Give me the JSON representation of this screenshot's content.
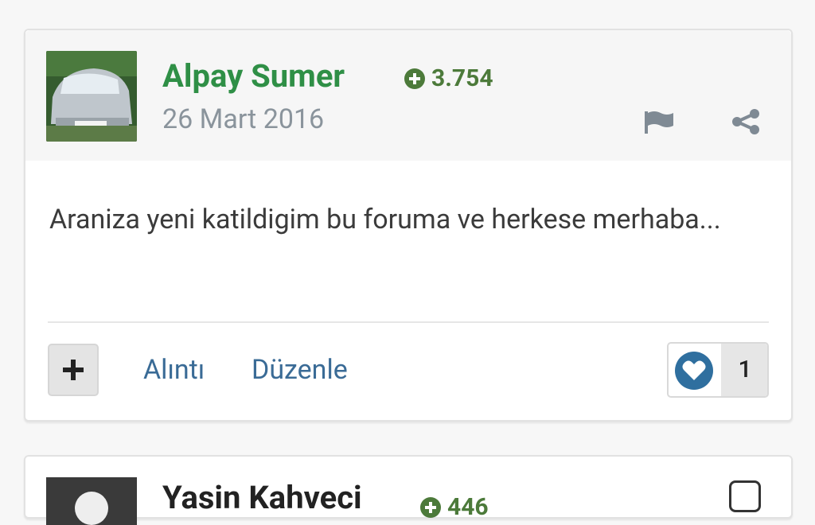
{
  "post": {
    "author": "Alpay Sumer",
    "reputation": "3.754",
    "date": "26 Mart 2016",
    "body": "Araniza yeni katildigim bu foruma ve herkese merhaba...",
    "actions": {
      "quote_label": "Alıntı",
      "edit_label": "Düzenle"
    },
    "like_count": "1"
  },
  "next_post": {
    "author": "Yasin Kahveci",
    "reputation": "446"
  },
  "colors": {
    "author": "#2f8f46",
    "reputation": "#4c7a3a",
    "link": "#3a6b96",
    "like": "#2f6f9f"
  },
  "icons": [
    "avatar",
    "reputation-plus-icon",
    "flag-icon",
    "share-icon",
    "plus-icon",
    "heart-icon",
    "checkbox-icon"
  ]
}
